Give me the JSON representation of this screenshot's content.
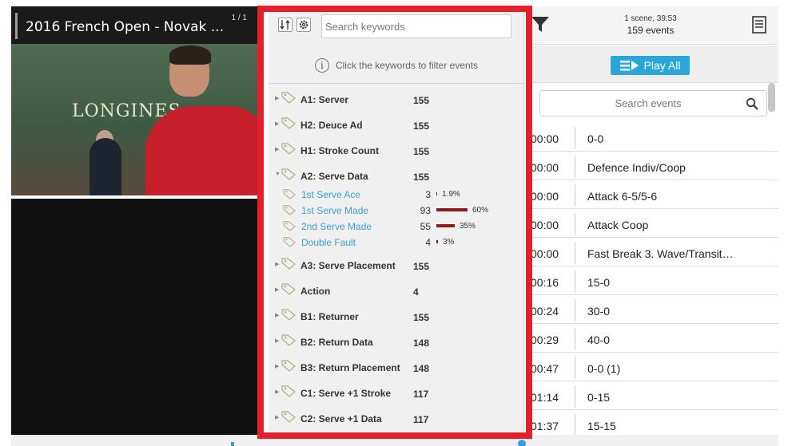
{
  "video": {
    "title": "2016 French Open - Novak ...",
    "counter": "1 / 1",
    "banner_text": "LONGINES"
  },
  "header": {
    "scene_info": "1 scene, 39:53",
    "events_count": "159 events"
  },
  "toolbar": {
    "play_all_label": "Play All"
  },
  "events_search": {
    "placeholder": "Search events"
  },
  "events": [
    {
      "time": "00:00",
      "desc": "0-0"
    },
    {
      "time": "00:00",
      "desc": "Defence Indiv/Coop"
    },
    {
      "time": "00:00",
      "desc": "Attack 6-5/5-6"
    },
    {
      "time": "00:00",
      "desc": "Attack Coop"
    },
    {
      "time": "00:00",
      "desc": "Fast Break 3. Wave/Transit…"
    },
    {
      "time": "00:16",
      "desc": "15-0"
    },
    {
      "time": "00:24",
      "desc": "30-0"
    },
    {
      "time": "00:29",
      "desc": "40-0"
    },
    {
      "time": "00:47",
      "desc": "0-0 (1)"
    },
    {
      "time": "01:14",
      "desc": "0-15"
    },
    {
      "time": "01:37",
      "desc": "15-15"
    }
  ],
  "keywords": {
    "search_placeholder": "Search keywords",
    "info_text": "Click the keywords to filter events",
    "groups": [
      {
        "name": "A1: Server",
        "count": "155"
      },
      {
        "name": "H2: Deuce Ad",
        "count": "155"
      },
      {
        "name": "H1: Stroke Count",
        "count": "155"
      },
      {
        "name": "A2: Serve Data",
        "count": "155",
        "expanded": true,
        "children": [
          {
            "name": "1st Serve Ace",
            "count": "3",
            "percent": "1.9%",
            "fraction": 0.019
          },
          {
            "name": "1st Serve Made",
            "count": "93",
            "percent": "60%",
            "fraction": 0.6
          },
          {
            "name": "2nd Serve Made",
            "count": "55",
            "percent": "35%",
            "fraction": 0.35
          },
          {
            "name": "Double Fault",
            "count": "4",
            "percent": "3%",
            "fraction": 0.03
          }
        ]
      },
      {
        "name": "A3: Serve Placement",
        "count": "155"
      },
      {
        "name": "Action",
        "count": "4"
      },
      {
        "name": "B1: Returner",
        "count": "155"
      },
      {
        "name": "B2: Return Data",
        "count": "148"
      },
      {
        "name": "B3: Return Placement",
        "count": "148"
      },
      {
        "name": "C1: Serve +1 Stroke",
        "count": "117"
      },
      {
        "name": "C2: Serve +1 Data",
        "count": "117"
      }
    ]
  },
  "colors": {
    "highlight": "#e4202a",
    "accent": "#2aa7d8",
    "keyword_link": "#3a9fd0",
    "bar": "#8b1a1a"
  },
  "icons": [
    "sort-icon",
    "gear-icon",
    "info-icon",
    "tag-icon",
    "filter-icon",
    "document-icon",
    "playlist-icon",
    "search-icon"
  ]
}
